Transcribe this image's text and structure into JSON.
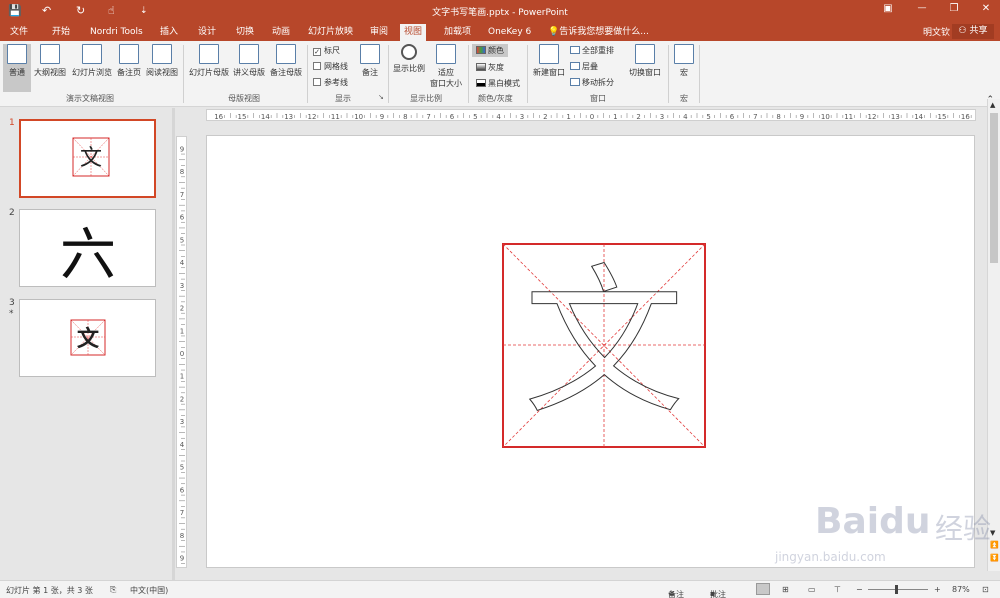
{
  "window": {
    "title": "文字书写笔画.pptx - PowerPoint"
  },
  "quick_access": {
    "save": "💾",
    "undo": "↶",
    "redo": "↻",
    "touch": "☝",
    "customize": "⇣"
  },
  "window_controls": {
    "restore_ribbon": "▣",
    "minimize": "—",
    "maximize": "❐",
    "close": "✕"
  },
  "tabs": [
    "文件",
    "开始",
    "Nordri Tools",
    "插入",
    "设计",
    "切换",
    "动画",
    "幻灯片放映",
    "审阅",
    "视图",
    "加载项",
    "OneKey 6"
  ],
  "active_tab": "视图",
  "tell_me": "告诉我您想要做什么...",
  "user_name": "明文钦",
  "share_label": "共享",
  "ribbon": {
    "presentation_views": {
      "label": "演示文稿视图",
      "buttons": [
        "普通",
        "大纲视图",
        "幻灯片浏览",
        "备注页",
        "阅读视图"
      ]
    },
    "master_views": {
      "label": "母版视图",
      "buttons": [
        "幻灯片母版",
        "讲义母版",
        "备注母版"
      ]
    },
    "show": {
      "label": "显示",
      "ruler": "标尺",
      "gridlines": "网格线",
      "guides": "参考线",
      "notes": "备注"
    },
    "zoom": {
      "label": "显示比例",
      "zoom_btn": "显示比例",
      "fit_line1": "适应",
      "fit_line2": "窗口大小"
    },
    "color": {
      "label": "颜色/灰度",
      "color": "颜色",
      "grayscale": "灰度",
      "bw": "黑白模式"
    },
    "window": {
      "label": "窗口",
      "new_window": "新建窗口",
      "arrange_all": "全部重排",
      "cascade": "层叠",
      "move_split": "移动拆分",
      "switch_windows": "切换窗口"
    },
    "macros": {
      "label": "宏",
      "macros_btn": "宏"
    }
  },
  "ruler_labels": [
    "16",
    "15",
    "14",
    "13",
    "12",
    "11",
    "10",
    "9",
    "8",
    "7",
    "6",
    "5",
    "4",
    "3",
    "2",
    "1",
    "0",
    "1",
    "2",
    "3",
    "4",
    "5",
    "6",
    "7",
    "8",
    "9",
    "10",
    "11",
    "12",
    "13",
    "14",
    "15",
    "16"
  ],
  "vruler_labels": [
    "9",
    "8",
    "7",
    "6",
    "5",
    "4",
    "3",
    "2",
    "1",
    "0",
    "1",
    "2",
    "3",
    "4",
    "5",
    "6",
    "7",
    "8",
    "9"
  ],
  "thumbnails": [
    {
      "number": "1",
      "glyph": "文",
      "star": ""
    },
    {
      "number": "2",
      "glyph": "六",
      "star": ""
    },
    {
      "number": "3",
      "glyph": "文",
      "star": "*"
    }
  ],
  "slide": {
    "character": "文"
  },
  "status": {
    "slide_info": "幻灯片 第 1 张，共 3 张",
    "language": "中文(中国)",
    "notes": "备注",
    "comments": "批注",
    "zoom": "87%"
  },
  "watermark": {
    "brand": "Baidu",
    "brand_cn": "经验",
    "url": "jingyan.baidu.com"
  },
  "colors": {
    "titlebar": "#b7472a",
    "accent_red": "#d42a2a",
    "guide_red": "#e23a3a"
  }
}
